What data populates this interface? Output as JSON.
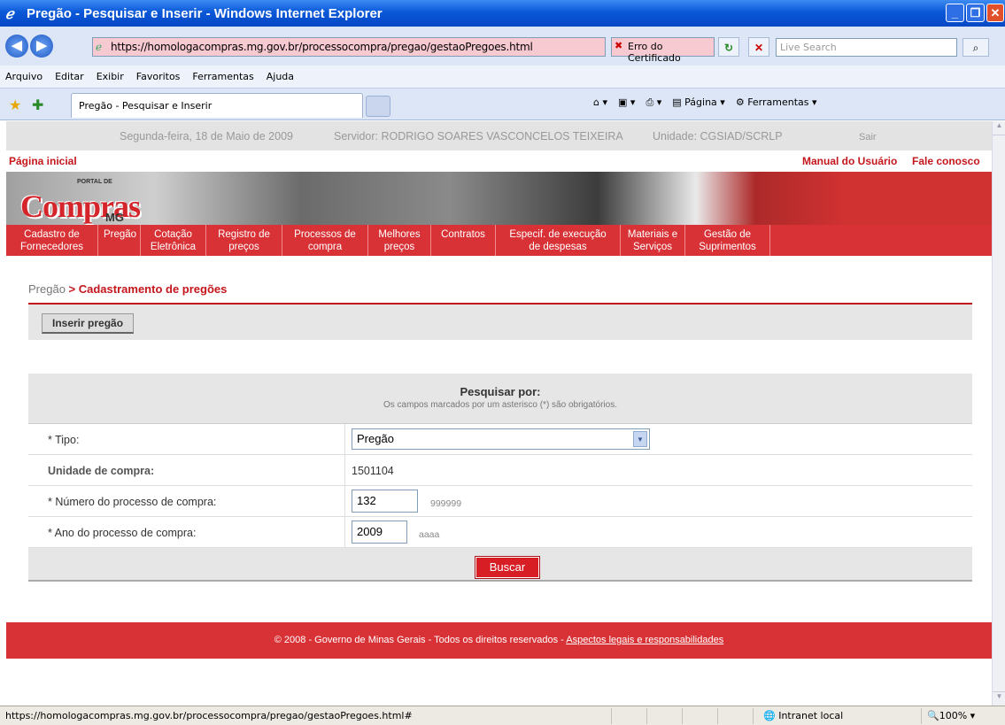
{
  "window": {
    "title": "Pregão - Pesquisar e Inserir - Windows Internet Explorer"
  },
  "address": {
    "url": "https://homologacompras.mg.gov.br/processocompra/pregao/gestaoPregoes.html",
    "cert_error": "Erro do Certificado",
    "search_placeholder": "Live Search"
  },
  "menu": [
    "Arquivo",
    "Editar",
    "Exibir",
    "Favoritos",
    "Ferramentas",
    "Ajuda"
  ],
  "tab": {
    "label": "Pregão - Pesquisar e Inserir"
  },
  "commandbar": {
    "page": "Página",
    "tools": "Ferramentas"
  },
  "site": {
    "date": "Segunda-feira, 18 de Maio de 2009",
    "server": "Servidor: RODRIGO SOARES VASCONCELOS TEIXEIRA",
    "unit": "Unidade: CGSIAD/SCRLP",
    "logout": "Sair",
    "home": "Página inicial",
    "manual": "Manual do Usuário",
    "contact": "Fale conosco",
    "logo": {
      "portal": "PORTAL DE",
      "name": "Compras",
      "state": "MG"
    },
    "nav": [
      {
        "l1": "Cadastro de",
        "l2": "Fornecedores"
      },
      {
        "l1": "Pregão",
        "l2": ""
      },
      {
        "l1": "Cotação",
        "l2": "Eletrônica"
      },
      {
        "l1": "Registro de",
        "l2": "preços"
      },
      {
        "l1": "Processos de",
        "l2": "compra"
      },
      {
        "l1": "Melhores",
        "l2": "preços"
      },
      {
        "l1": "Contratos",
        "l2": ""
      },
      {
        "l1": "Especif. de execução",
        "l2": "de despesas"
      },
      {
        "l1": "Materiais e",
        "l2": "Serviços"
      },
      {
        "l1": "Gestão de",
        "l2": "Suprimentos"
      }
    ],
    "breadcrumb": {
      "parent": "Pregão",
      "current": "> Cadastramento de pregões"
    },
    "insert_button": "Inserir pregão",
    "form": {
      "title": "Pesquisar por:",
      "subtitle": "Os campos marcados por um asterisco (*) são obrigatórios.",
      "tipo_label": "* Tipo:",
      "tipo_value": "Pregão",
      "unidade_label": "Unidade de compra:",
      "unidade_value": "1501104",
      "numero_label": "* Número do processo de compra:",
      "numero_value": "132",
      "numero_hint": "999999",
      "ano_label": "* Ano do processo de compra:",
      "ano_value": "2009",
      "ano_hint": "aaaa",
      "submit": "Buscar"
    },
    "footer": {
      "text": "© 2008 - Governo de Minas Gerais - Todos os direitos reservados - ",
      "link": "Aspectos legais e responsabilidades"
    }
  },
  "status": {
    "url": "https://homologacompras.mg.gov.br/processocompra/pregao/gestaoPregoes.html#",
    "zone": "Intranet local",
    "zoom": "100%"
  }
}
